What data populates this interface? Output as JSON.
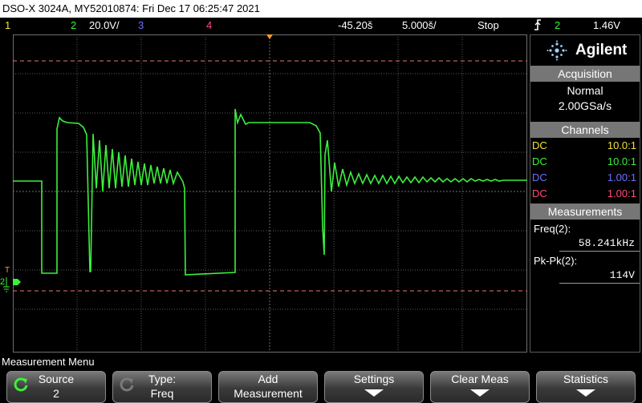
{
  "title": "DSO-X 3024A, MY52010874: Fri Dec 17 06:25:47 2021",
  "status": {
    "ch1_num": "1",
    "ch2_num": "2",
    "ch2_scale": "20.0V/",
    "ch3_num": "3",
    "ch4_num": "4",
    "time_delay": "-45.20š",
    "time_scale": "5.000š/",
    "run_state": "Stop",
    "trigger_icon": "trigger-slope-icon",
    "trigger_source": "2",
    "trigger_level": "1.46V"
  },
  "panel": {
    "logo_text": "Agilent",
    "acquisition": {
      "header": "Acquisition",
      "mode": "Normal",
      "rate": "2.00GSa/s"
    },
    "channels": {
      "header": "Channels",
      "rows": [
        {
          "coupling": "DC",
          "probe": "10.0:1",
          "color": "#f2e33a"
        },
        {
          "coupling": "DC",
          "probe": "10.0:1",
          "color": "#3cf03c"
        },
        {
          "coupling": "DC",
          "probe": "1.00:1",
          "color": "#6f6fff"
        },
        {
          "coupling": "DC",
          "probe": "1.00:1",
          "color": "#ff4a7c"
        }
      ]
    },
    "measurements": {
      "header": "Measurements",
      "items": [
        {
          "label": "Freq(2):",
          "value": "58.241kHz"
        },
        {
          "label": "Pk-Pk(2):",
          "value": "114V"
        }
      ]
    }
  },
  "menu": {
    "title": "Measurement Menu",
    "softkeys": [
      {
        "line1": "Source",
        "line2": "2",
        "icon": "rotate-knob-icon"
      },
      {
        "line1": "Type:",
        "line2": "Freq",
        "icon": "rotate-knob-icon"
      },
      {
        "line1": "Add",
        "line2": "Measurement"
      },
      {
        "line1": "Settings",
        "line2": ""
      },
      {
        "line1": "Clear Meas",
        "line2": ""
      },
      {
        "line1": "Statistics",
        "line2": ""
      }
    ]
  },
  "colors": {
    "ch1": "#f2e33a",
    "ch2": "#3cf03c",
    "ch3": "#6f6fff",
    "ch4": "#ff4a7c",
    "trigger_marker": "#ff9a2e",
    "cursor_line": "#e67a6a",
    "grid": "#5a5a5a"
  }
}
